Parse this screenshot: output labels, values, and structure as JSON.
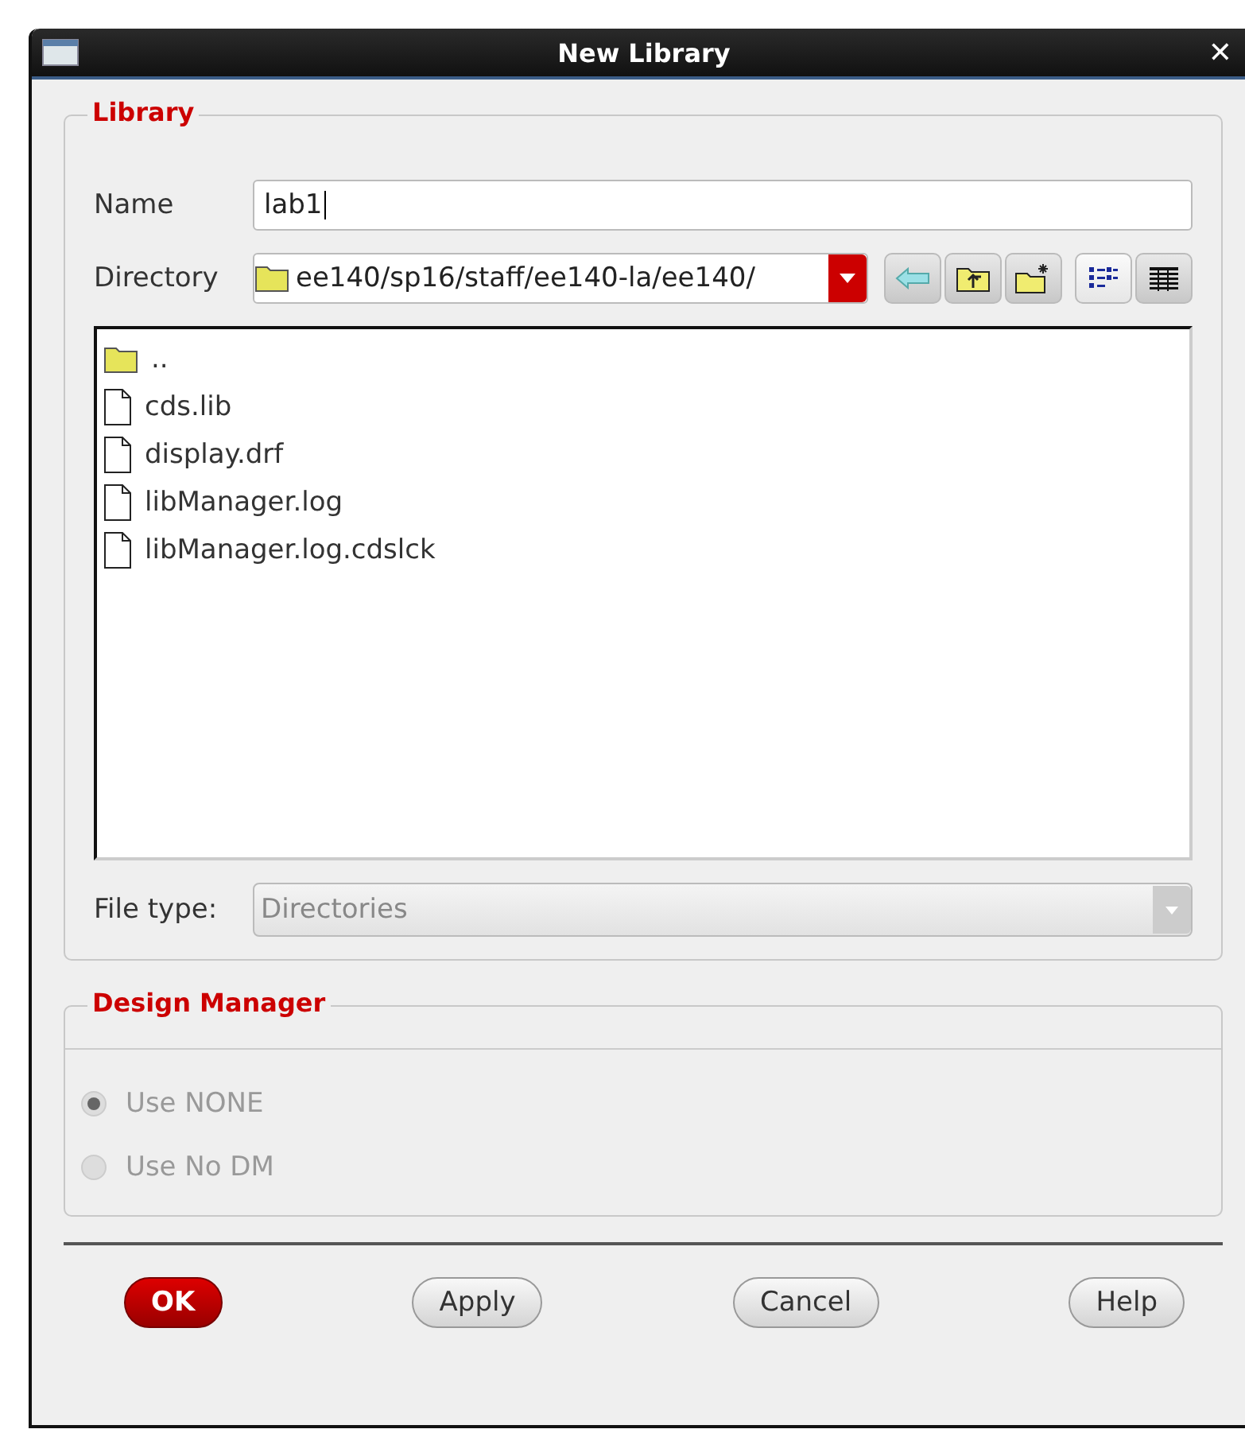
{
  "window": {
    "title": "New Library",
    "close": "✕"
  },
  "library": {
    "legend": "Library",
    "name_label": "Name",
    "name_value": "lab1",
    "directory_label": "Directory",
    "directory_value": "ee140/sp16/staff/ee140-la/ee140/",
    "nav_buttons": [
      {
        "kind": "back"
      },
      {
        "kind": "up"
      },
      {
        "kind": "new-folder"
      }
    ],
    "view_buttons": [
      {
        "kind": "list",
        "selected": true
      },
      {
        "kind": "details",
        "selected": false
      }
    ],
    "files": [
      {
        "kind": "folder",
        "name": ".."
      },
      {
        "kind": "file",
        "name": "cds.lib"
      },
      {
        "kind": "file",
        "name": "display.drf"
      },
      {
        "kind": "file",
        "name": "libManager.log"
      },
      {
        "kind": "file",
        "name": "libManager.log.cdslck"
      }
    ],
    "file_type_label": "File type:",
    "file_type_value": "Directories",
    "file_type_disabled": true
  },
  "design_manager": {
    "legend": "Design Manager",
    "disabled": true,
    "options": [
      {
        "label": "Use NONE",
        "selected": true
      },
      {
        "label": "Use No DM",
        "selected": false
      }
    ]
  },
  "buttons": [
    {
      "label": "OK",
      "kind": "default"
    },
    {
      "label": "Apply",
      "kind": "normal"
    },
    {
      "label": "Cancel",
      "kind": "normal"
    },
    {
      "label": "Help",
      "kind": "normal"
    }
  ]
}
